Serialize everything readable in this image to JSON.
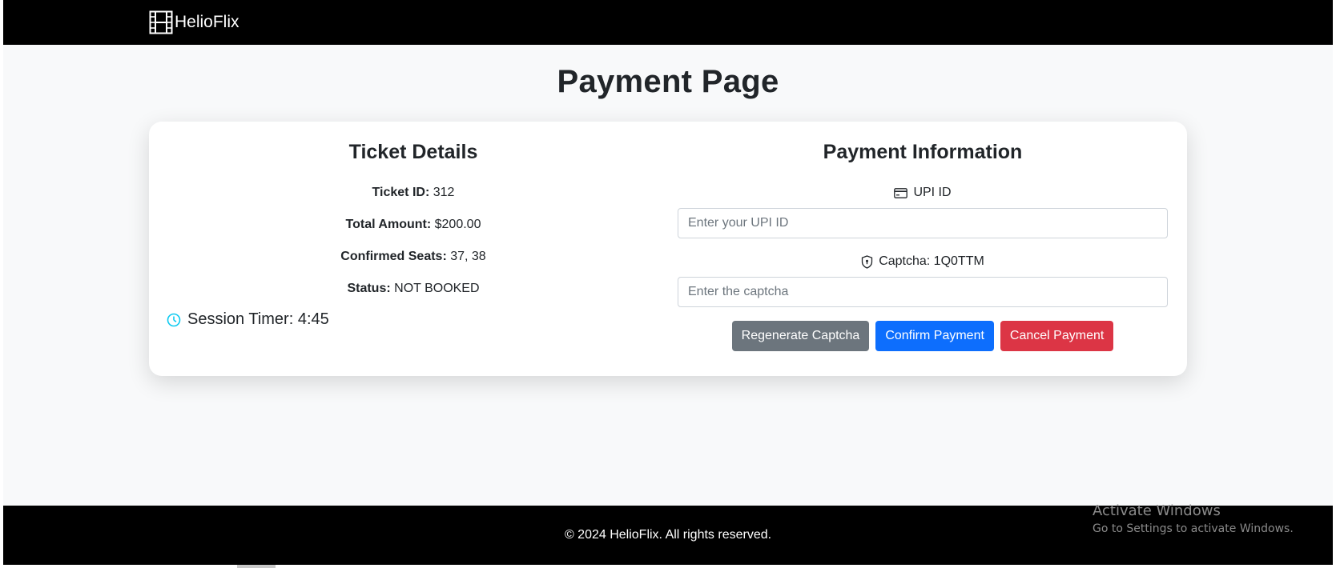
{
  "navbar": {
    "brand": "HelioFlix",
    "brand_icon": "film-icon"
  },
  "page_title": "Payment Page",
  "ticket": {
    "title": "Ticket Details",
    "id_label": "Ticket ID:",
    "id_value": "312",
    "amount_label": "Total Amount:",
    "amount_value": "$200.00",
    "seats_label": "Confirmed Seats:",
    "seats_value": "37, 38",
    "status_label": "Status:",
    "status_value": "NOT BOOKED",
    "timer_label": "Session Timer: 4:45",
    "timer_icon": "clock-icon",
    "timer_icon_color": "#0dcaf0"
  },
  "payment": {
    "title": "Payment Information",
    "upi_label": "UPI ID",
    "upi_icon": "credit-card-icon",
    "upi_placeholder": "Enter your UPI ID",
    "captcha_label": "Captcha: 1Q0TTM",
    "captcha_icon": "shield-icon",
    "captcha_placeholder": "Enter the captcha",
    "regenerate_label": "Regenerate Captcha",
    "confirm_label": "Confirm Payment",
    "cancel_label": "Cancel Payment"
  },
  "footer": {
    "text": "© 2024 HelioFlix. All rights reserved."
  },
  "watermark": {
    "title": "Activate Windows",
    "subtitle": "Go to Settings to activate Windows."
  },
  "colors": {
    "navbar": "#000000",
    "regenerate": "#6c757d",
    "confirm": "#0d6efd",
    "cancel": "#dc3545"
  }
}
